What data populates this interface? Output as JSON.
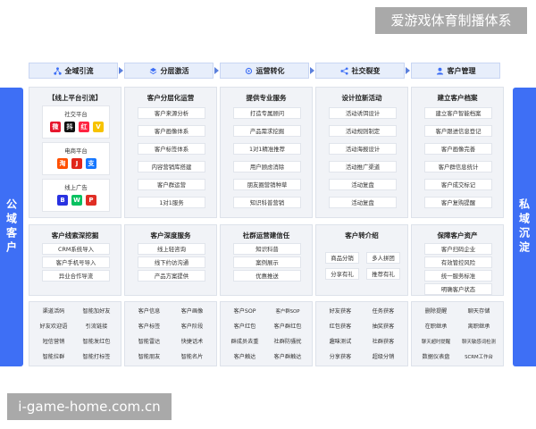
{
  "watermarks": {
    "top": "爱游戏体育制播体系",
    "bottom": "i-game-home.com.cn"
  },
  "sidebars": {
    "left": "公域客户",
    "right": "私域沉淀"
  },
  "colors": {
    "accent": "#3e6ff5",
    "stage_bg": "#e7eefb",
    "panel_bg": "#f1f3f7"
  },
  "stages": [
    {
      "label": "全域引流",
      "icon": "network-icon"
    },
    {
      "label": "分层激活",
      "icon": "layers-icon"
    },
    {
      "label": "运营转化",
      "icon": "cycle-icon"
    },
    {
      "label": "社交裂变",
      "icon": "share-icon"
    },
    {
      "label": "客户管理",
      "icon": "user-icon"
    }
  ],
  "row1": [
    {
      "title": "【线上平台引流】",
      "groups": [
        {
          "label": "社交平台",
          "logos": [
            "weibo-logo",
            "douyin-logo",
            "xiaohongshu-logo",
            "yellow-logo"
          ]
        },
        {
          "label": "电商平台",
          "logos": [
            "taobao-logo",
            "jd-logo",
            "alipay-logo"
          ]
        },
        {
          "label": "线上广告",
          "logos": [
            "baidu-logo",
            "wechat-logo",
            "pinduoduo-logo"
          ]
        }
      ]
    },
    {
      "title": "客户分层化运营",
      "items": [
        "客户来源分析",
        "客户画像体系",
        "客户标签体系",
        "内容营销库搭建",
        "客户群运营",
        "1对1服务"
      ]
    },
    {
      "title": "提供专业服务",
      "items": [
        "打造专属顾问",
        "产品需求挖掘",
        "1对1精准推荐",
        "用户顾虑消除",
        "朋友圈营销种草",
        "知识科普营销"
      ]
    },
    {
      "title": "设计拉新活动",
      "items": [
        "活动诱饵设计",
        "活动规则制定",
        "活动海报设计",
        "活动推广渠道",
        "活动复盘",
        "活动复盘"
      ]
    },
    {
      "title": "建立客户档案",
      "items": [
        "建立客户智能档案",
        "客户跟进信息登记",
        "客户画像完善",
        "客户群信息统计",
        "客户成交标记",
        "客户复购提醒"
      ]
    }
  ],
  "row2": [
    {
      "title": "客户线索深挖掘",
      "items": [
        "CRM系统导入",
        "客户手机号导入",
        "异业合作导流"
      ]
    },
    {
      "title": "客户深度服务",
      "items": [
        "线上轻咨询",
        "线下约访沟通",
        "产品方案提供"
      ]
    },
    {
      "title": "社群运营建信任",
      "items": [
        "知识科普",
        "案例展示",
        "优惠推送"
      ]
    },
    {
      "title": "客户转介绍",
      "items": [
        "商品分销",
        "多人拼团",
        "分享有礼",
        "推荐有礼"
      ]
    },
    {
      "title": "保障客户资产",
      "items": [
        "客户扫码企业",
        "有效管控风险",
        "统一服务标准",
        "明确客户状态"
      ]
    }
  ],
  "row3": [
    [
      "渠道活码",
      "智能加好友",
      "好友欢迎语",
      "引流链接",
      "短信营销",
      "智能发红包",
      "智能拉群",
      "智能打标签"
    ],
    [
      "客户信息",
      "客户画像",
      "客户标签",
      "客户阶段",
      "智能雷达",
      "快捷话术",
      "智能朋友",
      "智能名片"
    ],
    [
      "客户SOP",
      "客户群SOP",
      "客户红包",
      "客户群红包",
      "群成员去重",
      "社群防骚扰",
      "客户触达",
      "客户群触达"
    ],
    [
      "好友获客",
      "任务获客",
      "红包获客",
      "抽奖获客",
      "趣味测试",
      "社群获客",
      "分享获客",
      "超级分销"
    ],
    [
      "删除提醒",
      "聊天存储",
      "在职继承",
      "离职继承",
      "聊天超时提醒",
      "聊天敏感词检测",
      "数据仪表盘",
      "SCRM工作台"
    ]
  ]
}
